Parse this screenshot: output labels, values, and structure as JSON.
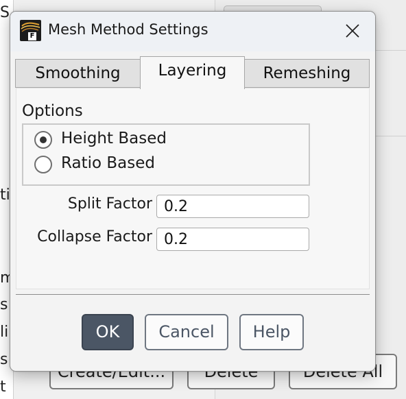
{
  "background": {
    "left_fragments": [
      "S",
      "ti",
      "m",
      "s",
      "li",
      "s",
      "t"
    ],
    "buttons": {
      "create_edit": "Create/Edit...",
      "delete": "Delete",
      "delete_all": "Delete All"
    }
  },
  "dialog": {
    "title": "Mesh Method Settings",
    "app_icon_letter": "F",
    "close_icon": "close-icon",
    "tabs": [
      {
        "label": "Smoothing",
        "active": false
      },
      {
        "label": "Layering",
        "active": true
      },
      {
        "label": "Remeshing",
        "active": false
      }
    ],
    "options": {
      "label": "Options",
      "radios": [
        {
          "label": "Height Based",
          "checked": true
        },
        {
          "label": "Ratio Based",
          "checked": false
        }
      ]
    },
    "fields": {
      "split_factor": {
        "label": "Split Factor",
        "value": "0.2"
      },
      "collapse_factor": {
        "label": "Collapse Factor",
        "value": "0.2"
      }
    },
    "buttons": {
      "ok": "OK",
      "cancel": "Cancel",
      "help": "Help"
    },
    "colors": {
      "primary_button": "#4b5665",
      "title_bar": "#eef1f5"
    }
  }
}
